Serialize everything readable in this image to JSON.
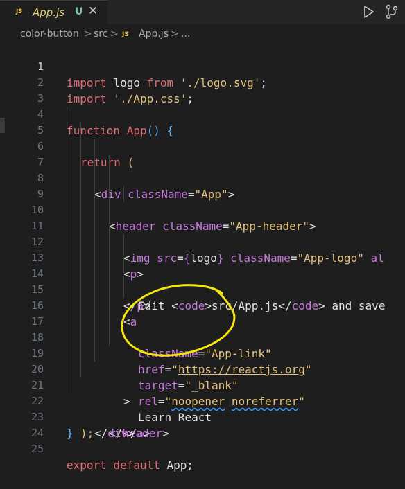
{
  "tab": {
    "icon": "JS",
    "label": "App.js",
    "badge": "U",
    "close": "✕"
  },
  "toolbar": {
    "run_icon": "play-icon",
    "split_icon": "split-editor-icon"
  },
  "breadcrumb": {
    "items": [
      "color-button",
      "src",
      "App.js",
      "..."
    ],
    "js_icon": "JS",
    "separator": ">"
  },
  "lines": [
    {
      "n": "1"
    },
    {
      "n": "2"
    },
    {
      "n": "3"
    },
    {
      "n": "4"
    },
    {
      "n": "5"
    },
    {
      "n": "6"
    },
    {
      "n": "7"
    },
    {
      "n": "8"
    },
    {
      "n": "9"
    },
    {
      "n": "10"
    },
    {
      "n": "11"
    },
    {
      "n": "12"
    },
    {
      "n": "13"
    },
    {
      "n": "14"
    },
    {
      "n": "15"
    },
    {
      "n": "16"
    },
    {
      "n": "17"
    },
    {
      "n": "18"
    },
    {
      "n": "19"
    },
    {
      "n": "20"
    },
    {
      "n": "21"
    },
    {
      "n": "22"
    },
    {
      "n": "23"
    },
    {
      "n": "24"
    },
    {
      "n": "25"
    }
  ],
  "code": {
    "l1": [
      "import",
      " logo ",
      "from",
      " './logo.svg'",
      ";"
    ],
    "l2": [
      "import",
      " './App.css'",
      ";"
    ],
    "l4": [
      "function",
      " App",
      "()",
      " {"
    ],
    "l5": [
      "return",
      " ("
    ],
    "l6": [
      "<",
      "div",
      " className",
      "=",
      "\"App\"",
      ">"
    ],
    "l7": [
      "<",
      "header",
      " className",
      "=",
      "\"App-header\"",
      ">"
    ],
    "l8": [
      "<",
      "img",
      " src",
      "=",
      "{",
      "logo",
      "}",
      " className",
      "=",
      "\"App-logo\"",
      " al"
    ],
    "l9": [
      "<",
      "p",
      ">"
    ],
    "l10": [
      "Edit ",
      "<",
      "code",
      ">",
      "src/App.js",
      "</",
      "code",
      ">",
      " and save"
    ],
    "l11": [
      "</",
      "p",
      ">"
    ],
    "l12": [
      "<",
      "a"
    ],
    "l13": [
      "className",
      "=",
      "\"App-link\""
    ],
    "l14": [
      "href",
      "=",
      "\"",
      "https://reactjs.org",
      "\""
    ],
    "l15": [
      "target",
      "=",
      "\"_blank\""
    ],
    "l16": [
      "rel",
      "=",
      "\"",
      "noopener",
      " ",
      "noreferrer",
      "\""
    ],
    "l17": [
      ">"
    ],
    "l18": [
      "Learn React"
    ],
    "l19": [
      "</",
      "a",
      ">"
    ],
    "l20": [
      "</",
      "header",
      ">"
    ],
    "l21": [
      "</",
      "div",
      ">"
    ],
    "l22": [
      ");"
    ],
    "l23": [
      "}"
    ],
    "l25": [
      "export",
      " default",
      " App",
      ";"
    ]
  },
  "colors": {
    "background": "#1e1e1e",
    "annotation": "#f5e50c"
  }
}
